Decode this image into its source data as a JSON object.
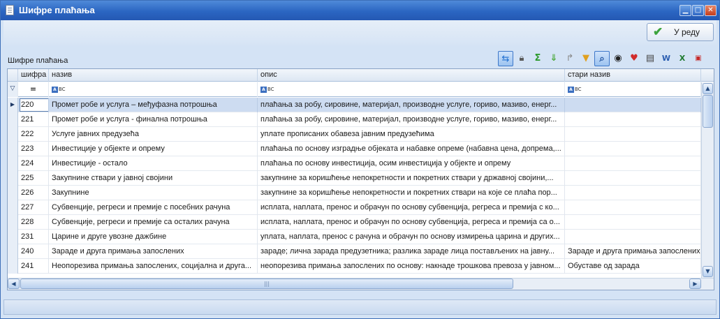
{
  "window": {
    "title": "Шифре плаћања"
  },
  "actions": {
    "ok_label": "У реду"
  },
  "grid": {
    "caption": "Шифре плаћања",
    "columns": [
      "шифра",
      "назив",
      "опис",
      "стари назив"
    ],
    "filter_text_icon_label": "A",
    "filter_text_icon_tail": "BC",
    "filter_equals_label": "=",
    "rows": [
      {
        "code": "220",
        "name": "Промет робе и услуга – међуфазна потрошња",
        "description": "плаћања за робу, сировине, материјал, производне услуге, гориво, мазиво, енерг...",
        "old_name": ""
      },
      {
        "code": "221",
        "name": "Промет робе и услуга - финална потрошња",
        "description": "плаћања за робу, сировине, материјал, производне услуге, гориво, мазиво, енерг...",
        "old_name": ""
      },
      {
        "code": "222",
        "name": "Услуге јавних предузећа",
        "description": "уплате прописаних обавеза јавним предузећима",
        "old_name": ""
      },
      {
        "code": "223",
        "name": "Инвестиције у објекте и опрему",
        "description": "плаћања по основу изградње објеката и набавке опреме (набавна цена, допрема,...",
        "old_name": ""
      },
      {
        "code": "224",
        "name": "Инвестиције - остало",
        "description": "плаћања по основу инвестиција, осим инвестиција у објекте и опрему",
        "old_name": ""
      },
      {
        "code": "225",
        "name": "Закупнине ствари у јавној својини",
        "description": "закупнине за коришћење непокретности и покретних ствари у државној својини,...",
        "old_name": ""
      },
      {
        "code": "226",
        "name": "Закупнине",
        "description": "закупнине за коришћење непокретности и покретних ствари на које се плаћа пор...",
        "old_name": ""
      },
      {
        "code": "227",
        "name": "Субвенције, регреси и премије с посебних рачуна",
        "description": "исплата, наплата, пренос и обрачун по основу субвенција, регреса и премија с ко...",
        "old_name": ""
      },
      {
        "code": "228",
        "name": "Субвенције, регреси и премије са осталих рачуна",
        "description": "исплата, наплата, пренос и обрачун по основу субвенција, регреса и премија са о...",
        "old_name": ""
      },
      {
        "code": "231",
        "name": "Царине и друге увозне дажбине",
        "description": "уплата, наплата, пренос с рачуна и обрачун по основу измирења царина и других...",
        "old_name": ""
      },
      {
        "code": "240",
        "name": "Зараде и друга примања запослених",
        "description": "зараде; лична зарада предузетника; разлика зараде лица постављених на јавну...",
        "old_name": "Зараде и друга примања запослених"
      },
      {
        "code": "241",
        "name": "Неопорезива примања запослених, социјална и друга...",
        "description": "неопорезива примања запослених по основу: накнаде трошкова превоза у јавном...",
        "old_name": "Обуставе од зарада"
      }
    ]
  },
  "icons": {
    "toolbar": [
      "refresh-icon",
      "lock-icon",
      "sum-icon",
      "expand-down-icon",
      "forward-icon",
      "filter-icon",
      "find-icon",
      "view-icon",
      "favorite-icon",
      "print-icon",
      "export-word-icon",
      "export-excel-icon",
      "export-pdf-icon"
    ]
  },
  "colors": {
    "titlebar": "#2b66c2",
    "selected_row": "#cddcf1",
    "accent": "#3d77c9"
  }
}
